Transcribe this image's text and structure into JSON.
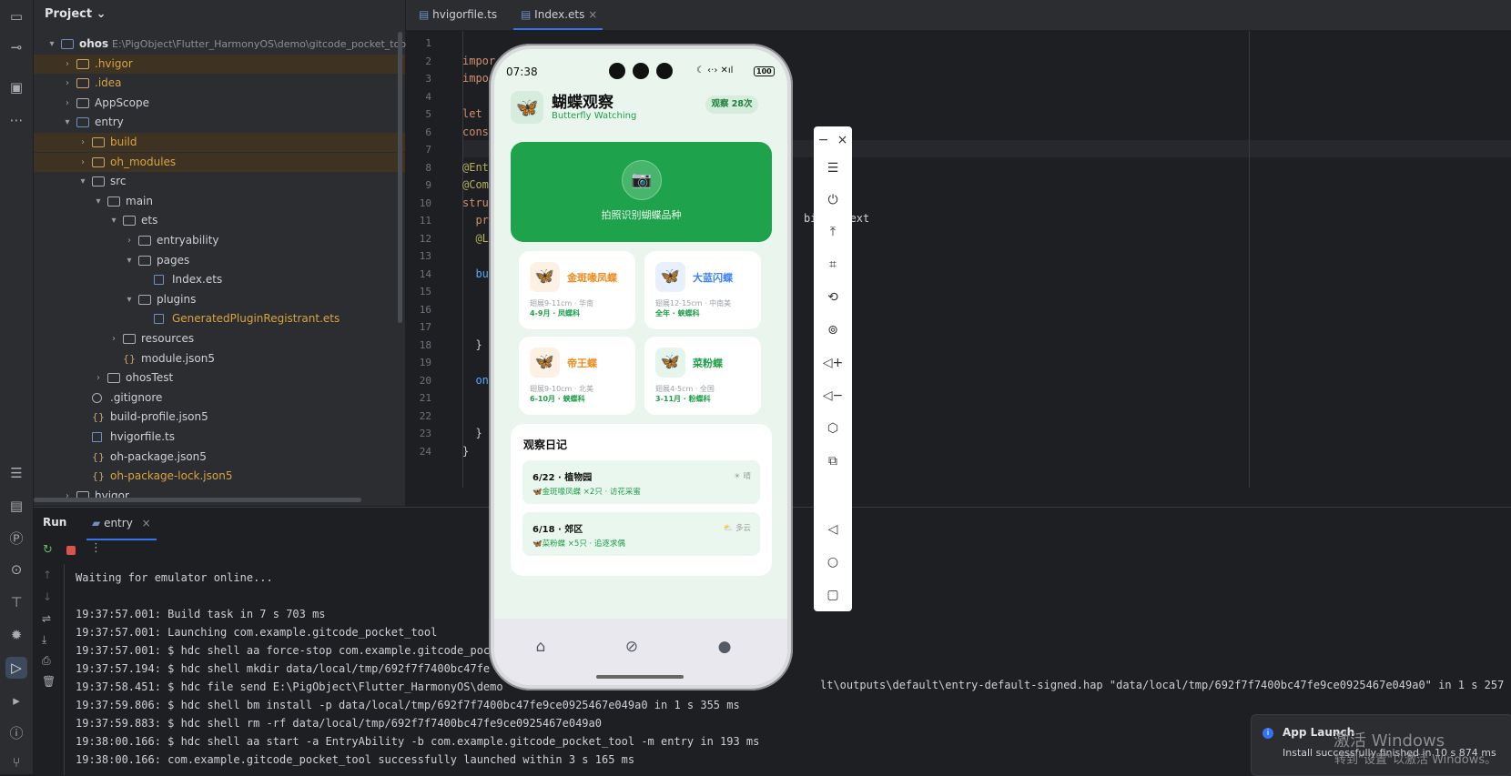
{
  "ide": {
    "project_label": "Project",
    "tree": [
      {
        "label": "ohos",
        "extra": "E:\\PigObject\\Flutter_HarmonyOS\\demo\\gitcode_pocket_tool\\oh",
        "depth": 0,
        "arrow": "▾",
        "type": "module",
        "style": "bold"
      },
      {
        "label": ".hvigor",
        "depth": 1,
        "arrow": "›",
        "type": "folder",
        "style": "orange",
        "hl": true
      },
      {
        "label": ".idea",
        "depth": 1,
        "arrow": "›",
        "type": "folder",
        "style": "orange"
      },
      {
        "label": "AppScope",
        "depth": 1,
        "arrow": "›",
        "type": "folder"
      },
      {
        "label": "entry",
        "depth": 1,
        "arrow": "▾",
        "type": "module"
      },
      {
        "label": "build",
        "depth": 2,
        "arrow": "›",
        "type": "folder",
        "style": "orange",
        "hl": true
      },
      {
        "label": "oh_modules",
        "depth": 2,
        "arrow": "›",
        "type": "folder",
        "style": "orange",
        "hl": true
      },
      {
        "label": "src",
        "depth": 2,
        "arrow": "▾",
        "type": "folder"
      },
      {
        "label": "main",
        "depth": 3,
        "arrow": "▾",
        "type": "folder"
      },
      {
        "label": "ets",
        "depth": 4,
        "arrow": "▾",
        "type": "folder"
      },
      {
        "label": "entryability",
        "depth": 5,
        "arrow": "›",
        "type": "folder"
      },
      {
        "label": "pages",
        "depth": 5,
        "arrow": "▾",
        "type": "folder"
      },
      {
        "label": "Index.ets",
        "depth": 6,
        "arrow": "",
        "type": "file"
      },
      {
        "label": "plugins",
        "depth": 5,
        "arrow": "▾",
        "type": "folder"
      },
      {
        "label": "GeneratedPluginRegistrant.ets",
        "depth": 6,
        "arrow": "",
        "type": "file",
        "style": "orange"
      },
      {
        "label": "resources",
        "depth": 4,
        "arrow": "›",
        "type": "folder"
      },
      {
        "label": "module.json5",
        "depth": 4,
        "arrow": "",
        "type": "json"
      },
      {
        "label": "ohosTest",
        "depth": 3,
        "arrow": "›",
        "type": "folder"
      },
      {
        "label": ".gitignore",
        "depth": 2,
        "arrow": "",
        "type": "ignore"
      },
      {
        "label": "build-profile.json5",
        "depth": 2,
        "arrow": "",
        "type": "json"
      },
      {
        "label": "hvigorfile.ts",
        "depth": 2,
        "arrow": "",
        "type": "file"
      },
      {
        "label": "oh-package.json5",
        "depth": 2,
        "arrow": "",
        "type": "json"
      },
      {
        "label": "oh-package-lock.json5",
        "depth": 2,
        "arrow": "",
        "type": "json",
        "style": "orange"
      },
      {
        "label": "hvigor",
        "depth": 1,
        "arrow": "›",
        "type": "folder"
      }
    ],
    "tabs": [
      {
        "label": "hvigorfile.ts",
        "active": false
      },
      {
        "label": "Index.ets",
        "active": true,
        "close": "×"
      }
    ],
    "code_lines": [
      {
        "n": "1",
        "t": ""
      },
      {
        "n": "2",
        "t": "impor"
      },
      {
        "n": "3",
        "t": "impo"
      },
      {
        "n": "4",
        "t": ""
      },
      {
        "n": "5",
        "t": "let"
      },
      {
        "n": "6",
        "t": "cons"
      },
      {
        "n": "7",
        "t": ""
      },
      {
        "n": "8",
        "t": "@Ent"
      },
      {
        "n": "9",
        "t": "@Com"
      },
      {
        "n": "10",
        "t": "stru"
      },
      {
        "n": "11",
        "t": "  pr"
      },
      {
        "n": "12",
        "t": "  @L"
      },
      {
        "n": "13",
        "t": ""
      },
      {
        "n": "14",
        "t": "  bu"
      },
      {
        "n": "15",
        "t": ""
      },
      {
        "n": "16",
        "t": ""
      },
      {
        "n": "17",
        "t": ""
      },
      {
        "n": "18",
        "t": "  }"
      },
      {
        "n": "19",
        "t": ""
      },
      {
        "n": "20",
        "t": "  on"
      },
      {
        "n": "21",
        "t": ""
      },
      {
        "n": "22",
        "t": ""
      },
      {
        "n": "23",
        "t": "  }"
      },
      {
        "n": "24",
        "t": "}"
      }
    ],
    "code_tail_line11": "bili  text",
    "run": {
      "run_label": "Run",
      "tab_label": "entry",
      "tab_close": "×",
      "console": [
        "Waiting for emulator online...",
        "",
        "19:37:57.001: Build task in 7 s 703 ms",
        "19:37:57.001: Launching com.example.gitcode_pocket_tool",
        "19:37:57.001: $ hdc shell aa force-stop com.example.gitcode_poc",
        "19:37:57.194: $ hdc shell mkdir data/local/tmp/692f7f7400bc47fe",
        "19:37:58.451: $ hdc file send E:\\PigObject\\Flutter_HarmonyOS\\demo",
        "19:37:59.806: $ hdc shell bm install -p data/local/tmp/692f7f7400bc47fe9ce0925467e049a0 in 1 s 355 ms",
        "19:37:59.883: $ hdc shell rm -rf data/local/tmp/692f7f7400bc47fe9ce0925467e049a0",
        "19:38:00.166: $ hdc shell aa start -a EntryAbility -b com.example.gitcode_pocket_tool -m entry in 193 ms",
        "19:38:00.166: com.example.gitcode_pocket_tool successfully launched within 3 s 165 ms"
      ],
      "console_tail_line7": "lt\\outputs\\default\\entry-default-signed.hap \"data/local/tmp/692f7f7400bc47fe9ce0925467e049a0\" in 1 s 257 ms"
    },
    "toast": {
      "title": "App Launch",
      "body": "Install successfully finished in 10 s 874 ms"
    },
    "watermark": {
      "line1": "激活 Windows",
      "line2": "转到\"设置\"以激活 Windows。"
    }
  },
  "phone": {
    "time": "07:38",
    "status_icons": "☾ ‹·› ✕ıl",
    "battery": "100",
    "app": {
      "title": "蝴蝶观察",
      "subtitle": "Butterfly Watching",
      "badge": "观察 28次",
      "camera_label": "拍照识别蝴蝶品种",
      "butterflies": [
        {
          "name": "金斑喙凤蝶",
          "size": "翅展9-11cm · 华南",
          "family": "4-9月 · 凤蝶科",
          "color": "#f08a1c",
          "bg": "#fdf1e3"
        },
        {
          "name": "大蓝闪蝶",
          "size": "翅展12-15cm · 中南美",
          "family": "全年 · 蛱蝶科",
          "color": "#3b82f6",
          "bg": "#e8f0fd"
        },
        {
          "name": "帝王蝶",
          "size": "翅展9-10cm · 北美",
          "family": "6-10月 · 蛱蝶科",
          "color": "#f08a1c",
          "bg": "#fdf1e3"
        },
        {
          "name": "菜粉蝶",
          "size": "翅展4-5cm · 全国",
          "family": "3-11月 · 粉蝶科",
          "color": "#1e9e4a",
          "bg": "#e6f5eb"
        }
      ],
      "diary_title": "观察日记",
      "diary": [
        {
          "date": "6/22 · 植物园",
          "weather": "☀ 晴",
          "note": "🦋金斑喙凤蝶 ×2只 · 访花采蜜"
        },
        {
          "date": "6/18 · 郊区",
          "weather": "⛅ 多云",
          "note": "🦋菜粉蝶 ×5只 · 追逐求偶"
        }
      ]
    }
  },
  "emulator_toolbar": {
    "minimize": "−",
    "close": "×"
  }
}
